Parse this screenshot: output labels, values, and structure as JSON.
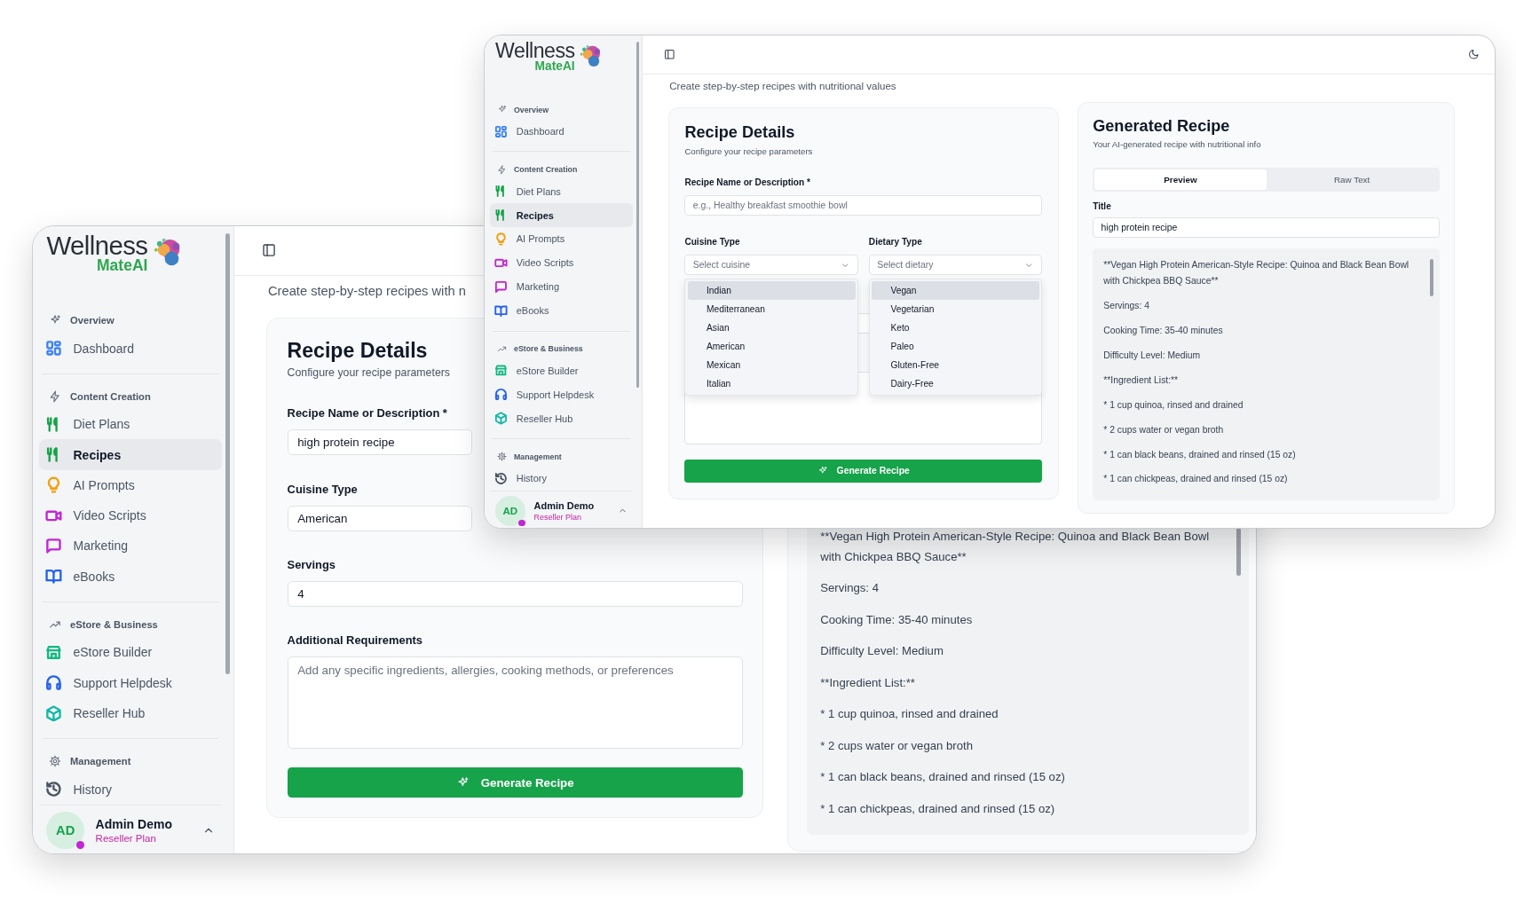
{
  "windows": [
    {
      "logo": {
        "word": "Wellness",
        "tagline": "MateAI"
      },
      "sidebar": {
        "sections": [
          {
            "label": "Overview",
            "items": [
              {
                "label": "Dashboard",
                "selected": false,
                "color": "#3b82f6"
              }
            ]
          },
          {
            "label": "Content Creation",
            "items": [
              {
                "label": "Diet Plans",
                "selected": false,
                "color": "#16a34a"
              },
              {
                "label": "Recipes",
                "selected": true,
                "color": "#16a34a"
              },
              {
                "label": "AI Prompts",
                "selected": false,
                "color": "#f59e0b"
              },
              {
                "label": "Video Scripts",
                "selected": false,
                "color": "#c026d3"
              },
              {
                "label": "Marketing",
                "selected": false,
                "color": "#c026d3"
              },
              {
                "label": "eBooks",
                "selected": false,
                "color": "#2563eb"
              }
            ]
          },
          {
            "label": "eStore & Business",
            "items": [
              {
                "label": "eStore Builder",
                "selected": false,
                "color": "#10b981"
              },
              {
                "label": "Support Helpdesk",
                "selected": false,
                "color": "#2563eb"
              },
              {
                "label": "Reseller Hub",
                "selected": false,
                "color": "#14b8a6"
              }
            ]
          },
          {
            "label": "Management",
            "items": [
              {
                "label": "History",
                "selected": false,
                "color": "#4b5563"
              }
            ]
          }
        ]
      },
      "user": {
        "initials": "AD",
        "name": "Admin Demo",
        "plan": "Reseller Plan",
        "online": true
      },
      "subtitle": "Create step-by-step recipes with n",
      "recipe_form": {
        "title": "Recipe Details",
        "subtitle": "Configure your recipe parameters",
        "fields": [
          {
            "kind": "text",
            "label": "Recipe Name or Description *",
            "value": "high protein recipe"
          },
          {
            "kind": "pair",
            "items": [
              {
                "kind": "select",
                "label": "Cuisine Type",
                "value": "American"
              }
            ]
          },
          {
            "kind": "text",
            "label": "Servings",
            "value": "4"
          },
          {
            "kind": "textarea",
            "label": "Additional Requirements",
            "placeholder": "Add any specific ingredients, allergies, cooking methods, or preferences"
          }
        ],
        "button": "Generate Recipe"
      },
      "generated_recipe": {
        "lines": [
          "**Vegan High Protein American-Style Recipe: Quinoa and Black Bean Bowl with Chickpea BBQ Sauce**",
          "Servings: 4",
          "Cooking Time: 35-40 minutes",
          "Difficulty Level: Medium",
          "**Ingredient List:**",
          "* 1 cup quinoa, rinsed and drained",
          "* 2 cups water or vegan broth",
          "* 1 can black beans, drained and rinsed (15 oz)",
          "* 1 can chickpeas, drained and rinsed (15 oz)"
        ]
      }
    },
    {
      "logo": {
        "word": "Wellness",
        "tagline": "MateAI"
      },
      "sidebar": {
        "sections": [
          {
            "label": "Overview",
            "items": [
              {
                "label": "Dashboard",
                "selected": false,
                "color": "#3b82f6"
              }
            ]
          },
          {
            "label": "Content Creation",
            "items": [
              {
                "label": "Diet Plans",
                "selected": false,
                "color": "#16a34a"
              },
              {
                "label": "Recipes",
                "selected": true,
                "color": "#16a34a"
              },
              {
                "label": "AI Prompts",
                "selected": false,
                "color": "#f59e0b"
              },
              {
                "label": "Video Scripts",
                "selected": false,
                "color": "#c026d3"
              },
              {
                "label": "Marketing",
                "selected": false,
                "color": "#c026d3"
              },
              {
                "label": "eBooks",
                "selected": false,
                "color": "#2563eb"
              }
            ]
          },
          {
            "label": "eStore & Business",
            "items": [
              {
                "label": "eStore Builder",
                "selected": false,
                "color": "#10b981"
              },
              {
                "label": "Support Helpdesk",
                "selected": false,
                "color": "#2563eb"
              },
              {
                "label": "Reseller Hub",
                "selected": false,
                "color": "#14b8a6"
              }
            ]
          },
          {
            "label": "Management",
            "items": [
              {
                "label": "History",
                "selected": false,
                "color": "#4b5563"
              }
            ]
          }
        ]
      },
      "user": {
        "initials": "AD",
        "name": "Admin Demo",
        "plan": "Reseller Plan",
        "online": true
      },
      "subtitle": "Create step-by-step recipes with nutritional values",
      "recipe_form": {
        "title": "Recipe Details",
        "subtitle": "Configure your recipe parameters",
        "fields": [
          {
            "kind": "text",
            "label": "Recipe Name or Description *",
            "placeholder": "e.g., Healthy breakfast smoothie bowl"
          },
          {
            "kind": "pair",
            "items": [
              {
                "kind": "select",
                "label": "Cuisine Type",
                "placeholder": "Select cuisine",
                "options": [
                  {
                    "label": "Indian",
                    "highlighted": true
                  },
                  {
                    "label": "Mediterranean",
                    "highlighted": false
                  },
                  {
                    "label": "Asian",
                    "highlighted": false
                  },
                  {
                    "label": "American",
                    "highlighted": false
                  },
                  {
                    "label": "Mexican",
                    "highlighted": false
                  },
                  {
                    "label": "Italian",
                    "highlighted": false
                  }
                ]
              },
              {
                "kind": "select",
                "label": "Dietary Type",
                "placeholder": "Select dietary",
                "options": [
                  {
                    "label": "Vegan",
                    "highlighted": true
                  },
                  {
                    "label": "Vegetarian",
                    "highlighted": false
                  },
                  {
                    "label": "Keto",
                    "highlighted": false
                  },
                  {
                    "label": "Paleo",
                    "highlighted": false
                  },
                  {
                    "label": "Gluten-Free",
                    "highlighted": false
                  },
                  {
                    "label": "Dairy-Free",
                    "highlighted": false
                  }
                ]
              }
            ]
          },
          {
            "kind": "text"
          },
          {
            "kind": "textarea"
          }
        ],
        "button": "Generate Recipe"
      },
      "generated_recipe": {
        "title": "Generated Recipe",
        "subtitle": "Your AI-generated recipe with nutritional info",
        "tabs": [
          {
            "label": "Preview",
            "selected": true
          },
          {
            "label": "Raw Text",
            "selected": false
          }
        ],
        "title_field": {
          "label": "Title",
          "value": "high protein recipe"
        },
        "lines": [
          "**Vegan High Protein American-Style Recipe: Quinoa and Black Bean Bowl with Chickpea BBQ Sauce**",
          "Servings: 4",
          "Cooking Time: 35-40 minutes",
          "Difficulty Level: Medium",
          "**Ingredient List:**",
          "* 1 cup quinoa, rinsed and drained",
          "* 2 cups water or vegan broth",
          "* 1 can black beans, drained and rinsed (15 oz)",
          "* 1 can chickpeas, drained and rinsed (15 oz)"
        ]
      }
    }
  ]
}
